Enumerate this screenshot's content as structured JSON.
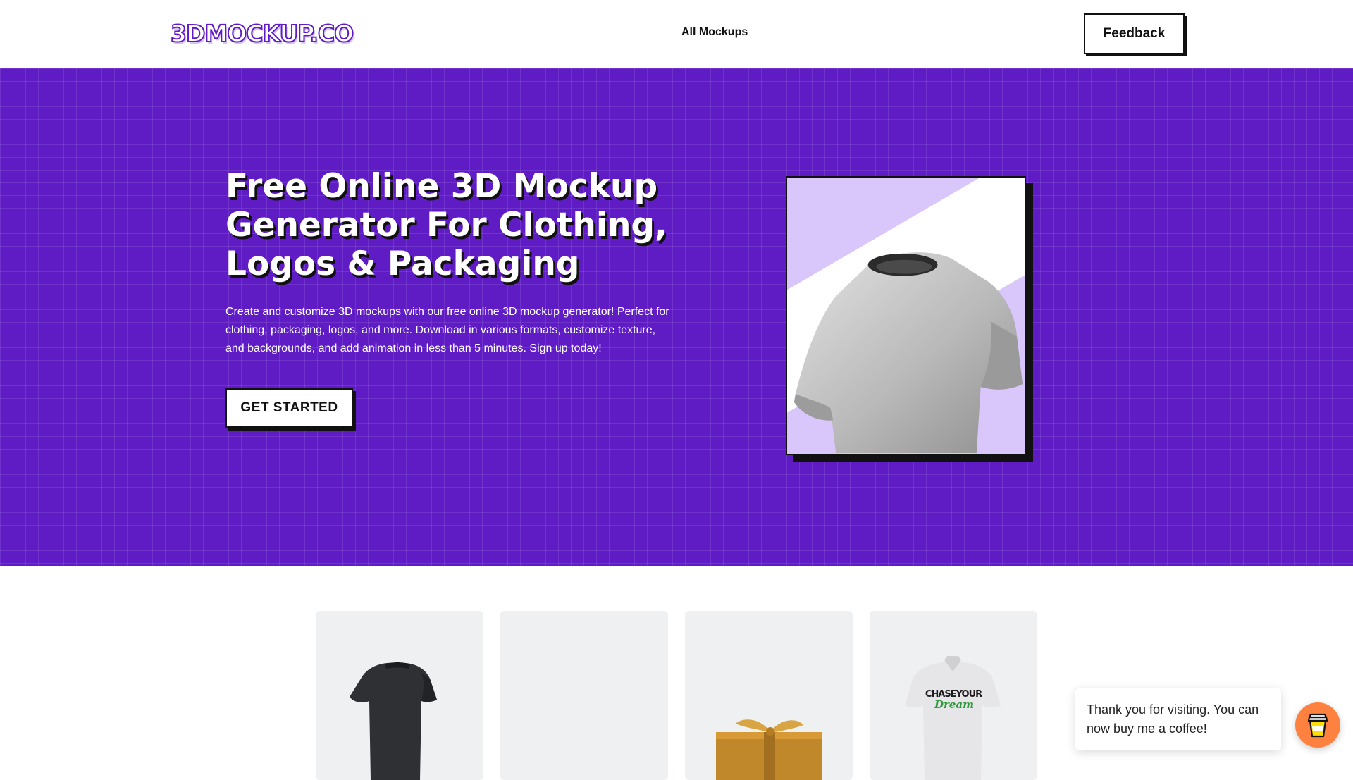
{
  "header": {
    "logo": "3DMOCKUP.CO",
    "nav_all_mockups": "All Mockups",
    "feedback_label": "Feedback"
  },
  "hero": {
    "title": "Free Online 3D Mockup Generator For Clothing, Logos & Packaging",
    "description": "Create and customize 3D mockups with our free online 3D mockup generator! Perfect for clothing, packaging, logos, and more. Download in various formats, customize texture, and backgrounds, and add animation in less than 5 minutes. Sign up today!",
    "cta_label": "GET STARTED"
  },
  "cards": [
    {
      "icon": "dark-tshirt-icon"
    },
    {
      "icon": "blank-card"
    },
    {
      "icon": "gift-box-icon"
    },
    {
      "icon": "white-polo-shirt-icon",
      "print_text": "CHASEYOUR Dream"
    }
  ],
  "coffee_widget": {
    "message": "Thank you for visiting. You can now buy me a coffee!",
    "icon": "coffee-cup-icon"
  },
  "colors": {
    "brand_purple": "#5f1bc4",
    "accent_lavender": "#d9c6fb",
    "coffee_orange": "#ff813f"
  }
}
